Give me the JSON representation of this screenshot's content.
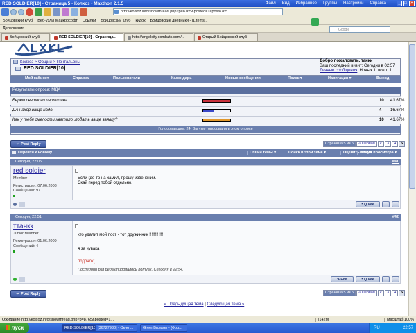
{
  "window": {
    "title": "RED SOLDIER[10] - Страница 5 - Колхоз - Maxthon 2.1.5",
    "menu": [
      "Файл",
      "Вид",
      "Избранное",
      "Группы",
      "Настройки",
      "Справка"
    ]
  },
  "address": {
    "url": "http://kolxoz.info/showthread.php?p=8765&posted=1#post8765"
  },
  "linksbar": [
    "Бойцовский клуб",
    "Веб-узлы Майкрософт",
    "Ссылки",
    "Бойцовский клуб",
    "кидок",
    "Бойцовские дневники - (Litems..."
  ],
  "addons": {
    "label": "Дополнения"
  },
  "google": {
    "placeholder": "Google"
  },
  "tabs": [
    "Бойцовский клуб",
    "RED SOLDIER[10] - Страница...",
    "http://angelcity.combats.com/...",
    "Старый Бойцовский клуб"
  ],
  "header": {
    "logo": "Колхоз",
    "breadcrumb": "Колхоз > Общий > Почтальоны",
    "thread_title": "RED SOLDIER[10]",
    "welcome_line1": "Добро пожаловать, танки",
    "welcome_line2": "Ваш последний визит: Сегодня в 02:57",
    "welcome_line3a": "Личные сообщения",
    "welcome_line3b": ": Новых 1, всего 1."
  },
  "navbar": [
    "Мой кабинет",
    "Справка",
    "Пользователи",
    "Календарь",
    "Новые сообщения",
    "Поиск ▾",
    "Навигация ▾",
    "Выход"
  ],
  "poll": {
    "title": "Результаты опроса: МДА",
    "options": [
      {
        "text": "Берем светлого партизана.",
        "count": "10",
        "pct": "41.67%",
        "fraction": 0.4167,
        "color": "#c8323c"
      },
      {
        "text": "ДА нахер ваще надо.",
        "count": "4",
        "pct": "16.67%",
        "fraction": 0.1667,
        "color": "#3a48c8"
      },
      {
        "text": "Как у тебя смелости хватило ,подать ваще заявку?",
        "count": "10",
        "pct": "41.67%",
        "fraction": 0.4167,
        "color": "#e0962a"
      }
    ],
    "footer": "Голосовавшие: 24. Вы уже голосовали в этом опросе"
  },
  "reply_button": "Post Reply",
  "pager": {
    "label": "Страница 5 из 5",
    "first": "« Первая",
    "prev": "<",
    "pages": [
      "3",
      "4",
      "5"
    ]
  },
  "threadtools": {
    "goto_new": "Перейти к новому",
    "items": [
      "Опции темы ▾",
      "Поиск в этой теме ▾",
      "Оценить тему ▾",
      "Опции просмотра ▾"
    ]
  },
  "posts": [
    {
      "date": "Сегодня, 22:05",
      "num": "#41",
      "username": "red soldier",
      "user_title": "Member",
      "reg": "Регистрация: 07.06.2008",
      "msgs": "Сообщений: 97",
      "lines": [
        "Если где-то на хамил, прошу извенений.",
        "Скай перед тобой отдельно."
      ],
      "quote": "Quote"
    },
    {
      "date": "Сегодня, 22:51",
      "num": "#42",
      "username": "ттанкк",
      "user_title": "Junior Member",
      "reg": "Регистрация: 01.06.2009",
      "msgs": "Сообщений: 4",
      "line1": "кто удалит мой пост - тот дружинник !!!!!!!!!!!!",
      "line2": "я за чувака",
      "line3": "подонок(",
      "edited": "Последний раз редактировалось homyak, Сегодня в 22:54.",
      "edit": "Edit",
      "quote": "Quote"
    }
  ],
  "bottom": {
    "prev": "« Предыдущая тема",
    "sep": "|",
    "next": "Следующая тема »"
  },
  "status": {
    "text": "Ожидание http://kolxoz.info/showthread.php?p=8765&posted=1...",
    "mem": "|142M",
    "zoom": "Масштаб:100%"
  },
  "taskbar": {
    "start": "пуск",
    "tasks": [
      "RED SOLDIER[10] - C...",
      "[36727930] - Окно ...",
      "GreenBrowser - [Фор..."
    ],
    "lang": "RU",
    "time": "22:57"
  },
  "colors": {
    "accent": "#6a7fae",
    "link": "#22229c",
    "head": "#5a6f9e"
  }
}
